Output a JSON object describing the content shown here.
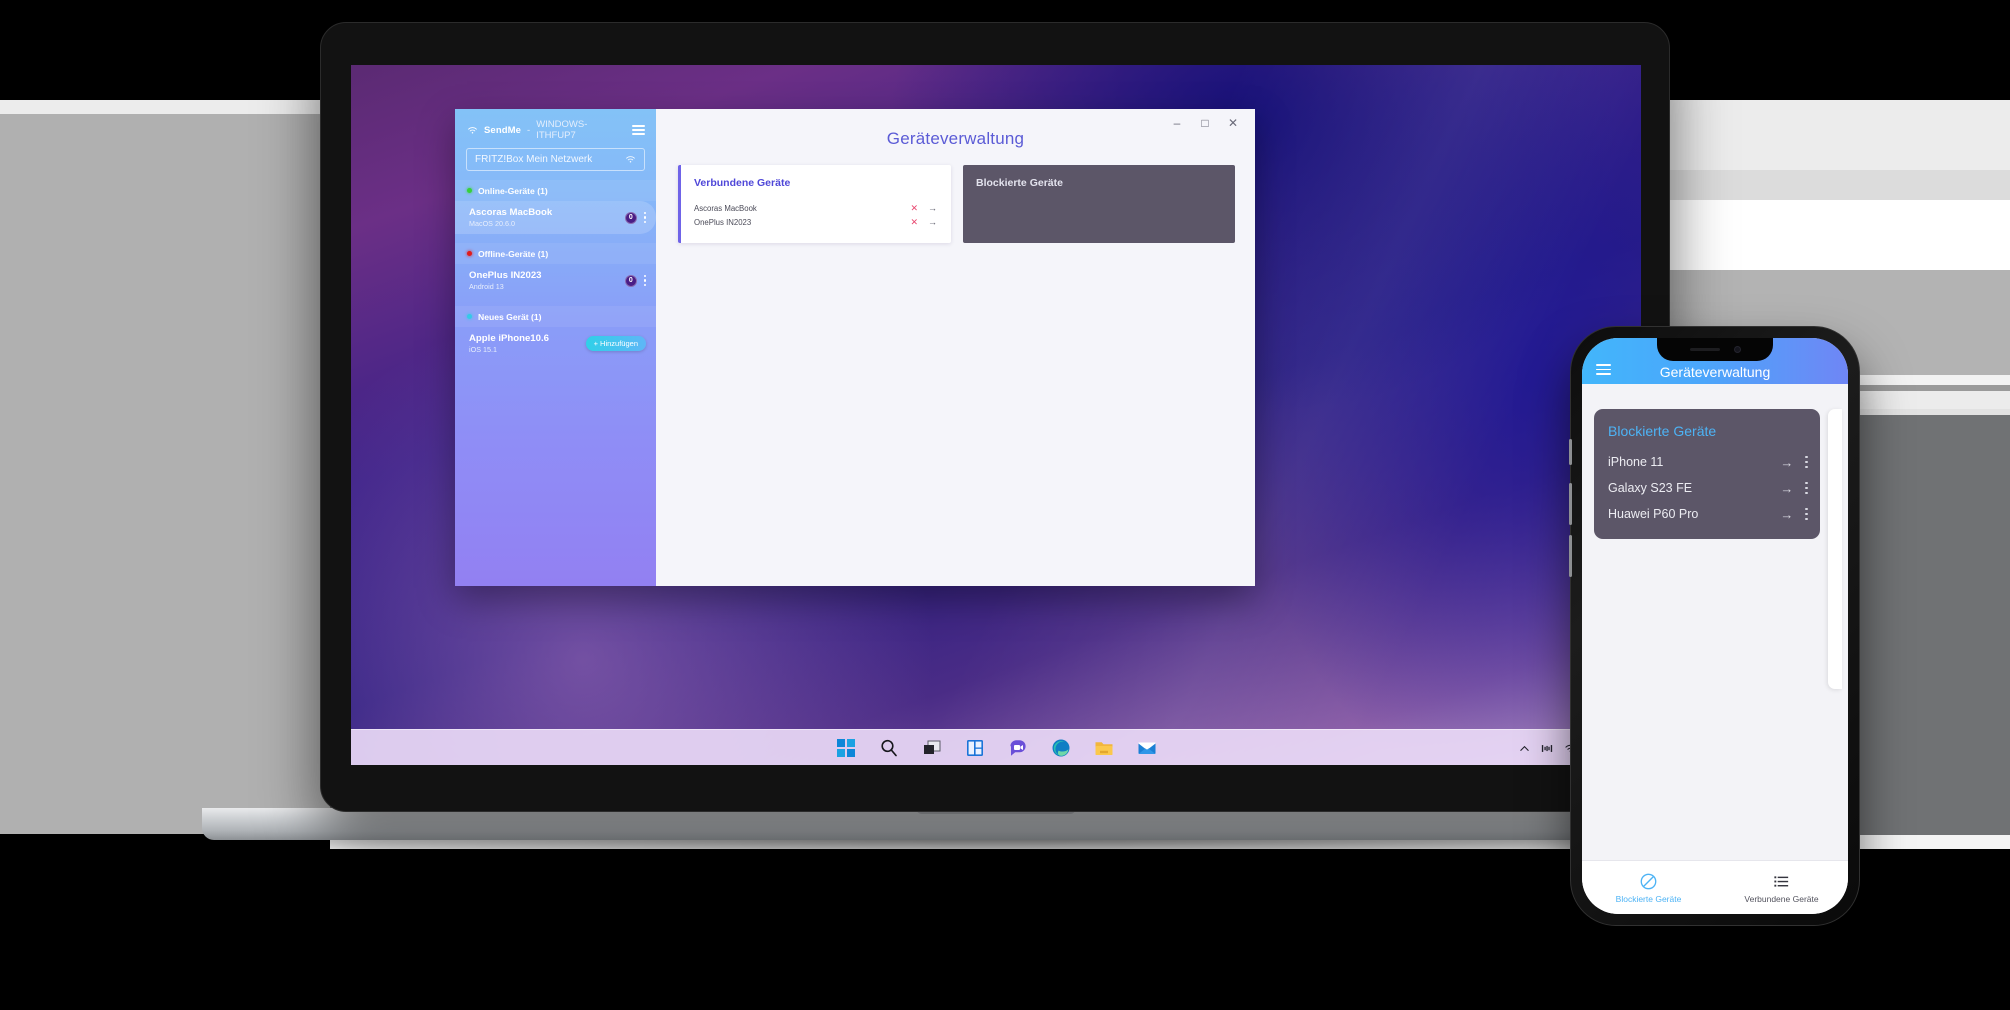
{
  "desktop": {
    "taskbar": {
      "icons": [
        "windows-start-icon",
        "search-icon",
        "task-view-icon",
        "widgets-icon",
        "chat-icon",
        "edge-icon",
        "file-explorer-icon",
        "mail-icon"
      ],
      "tray": [
        "chevron-up-icon",
        "network-icon",
        "wifi-icon",
        "volume-icon",
        "battery-icon"
      ]
    }
  },
  "app": {
    "window_controls": {
      "minimize": "–",
      "maximize": "□",
      "close": "✕"
    },
    "sidebar": {
      "app_name": "SendMe",
      "separator": "-",
      "host_name": "WINDOWS-ITHFUP7",
      "menu_icon": "hamburger-icon",
      "wifi_icon": "wifi-icon",
      "network": {
        "label": "FRITZ!Box Mein Netzwerk",
        "icon": "wifi-icon"
      },
      "groups": [
        {
          "label": "Online-Geräte (1)",
          "status": "online",
          "devices": [
            {
              "name": "Ascoras MacBook",
              "os": "MacOS 20.6.0",
              "badge": "0",
              "selected": true,
              "action": null
            }
          ]
        },
        {
          "label": "Offline-Geräte (1)",
          "status": "offline",
          "devices": [
            {
              "name": "OnePlus IN2023",
              "os": "Android 13",
              "badge": "0",
              "selected": false,
              "action": null
            }
          ]
        },
        {
          "label": "Neues Gerät (1)",
          "status": "new",
          "devices": [
            {
              "name": "Apple iPhone10.6",
              "os": "iOS 15.1",
              "badge": null,
              "selected": false,
              "action": "+ Hinzufügen"
            }
          ]
        }
      ]
    },
    "main": {
      "title": "Geräteverwaltung",
      "cards": [
        {
          "title": "Verbundene Geräte",
          "rows": [
            {
              "name": "Ascoras MacBook",
              "remove": "✕",
              "open": "→"
            },
            {
              "name": "OnePlus IN2023",
              "remove": "✕",
              "open": "→"
            }
          ]
        },
        {
          "title": "Blockierte Geräte",
          "rows": []
        }
      ]
    }
  },
  "phone": {
    "menu_icon": "hamburger-icon",
    "title": "Geräteverwaltung",
    "card": {
      "title": "Blockierte Geräte",
      "rows": [
        {
          "name": "iPhone 11",
          "open": "→",
          "menu": "kebab-icon"
        },
        {
          "name": "Galaxy S23 FE",
          "open": "→",
          "menu": "kebab-icon"
        },
        {
          "name": "Huawei P60 Pro",
          "open": "→",
          "menu": "kebab-icon"
        }
      ]
    },
    "tabs": [
      {
        "label": "Blockierte Geräte",
        "icon": "block-icon",
        "active": true
      },
      {
        "label": "Verbundene Geräte",
        "icon": "list-icon",
        "active": false
      }
    ]
  },
  "colors": {
    "accent_purple": "#5b5bd6",
    "card_title": "#4f47d8",
    "blocked_card_bg": "#5c5668",
    "phone_accent": "#4db3f5",
    "remove_red": "#e8476f",
    "online_green": "#37d13a",
    "offline_red": "#e01b1b",
    "new_cyan": "#35c9e8"
  }
}
